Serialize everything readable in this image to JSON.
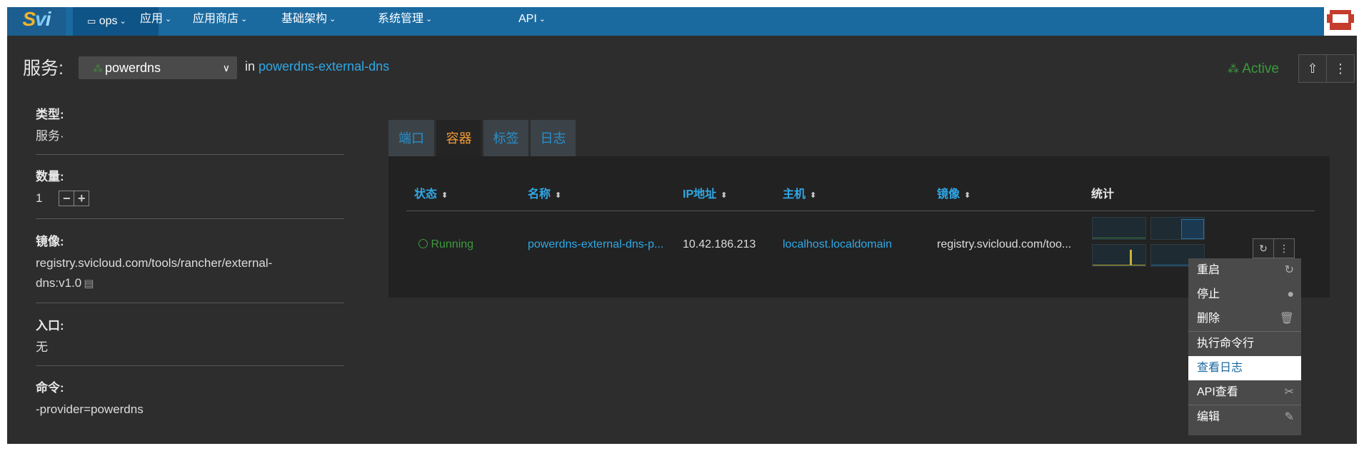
{
  "nav": {
    "logo": {
      "s": "S",
      "v": "v",
      "i": "i"
    },
    "env": "ops",
    "items": [
      "应用",
      "应用商店",
      "基础架构",
      "系统管理",
      "API"
    ]
  },
  "header": {
    "title": "服务:",
    "service_name": "powerdns",
    "in_label": "in",
    "stack_link": "powerdns-external-dns",
    "state": "Active",
    "active_color": "#3d9a3d"
  },
  "info": {
    "type_label": "类型:",
    "type_value": "服务·",
    "scale_label": "数量:",
    "scale_value": "1",
    "image_label": "镜像:",
    "image_value": "registry.svicloud.com/tools/rancher/external-dns:v1.0",
    "entry_label": "入口:",
    "entry_value": "无",
    "command_label": "命令:",
    "command_value": "-provider=powerdns"
  },
  "tabs": [
    {
      "label": "端口"
    },
    {
      "label": "容器"
    },
    {
      "label": "标签"
    },
    {
      "label": "日志"
    }
  ],
  "table": {
    "columns": [
      "状态",
      "名称",
      "IP地址",
      "主机",
      "镜像",
      "统计"
    ],
    "rows": [
      {
        "status": "Running",
        "name": "powerdns-external-dns-p...",
        "ip": "10.42.186.213",
        "host": "localhost.localdomain",
        "image": "registry.svicloud.com/too..."
      }
    ]
  },
  "menu": {
    "items": [
      {
        "label": "重启",
        "icon": "restart-icon"
      },
      {
        "label": "停止",
        "icon": "stop-icon"
      },
      {
        "label": "删除",
        "icon": "trash-icon"
      },
      {
        "label": "执行命令行",
        "icon": ""
      },
      {
        "label": "查看日志",
        "icon": ""
      },
      {
        "label": "API查看",
        "icon": "api-view-icon"
      },
      {
        "label": "编辑",
        "icon": "edit-icon"
      }
    ],
    "highlighted": "查看日志"
  },
  "colors": {
    "nav": "#1a6aa0",
    "link": "#2fa8e6",
    "active_tab": "#f29a38",
    "running": "#3d9a3d",
    "background": "#2d2d2d"
  }
}
